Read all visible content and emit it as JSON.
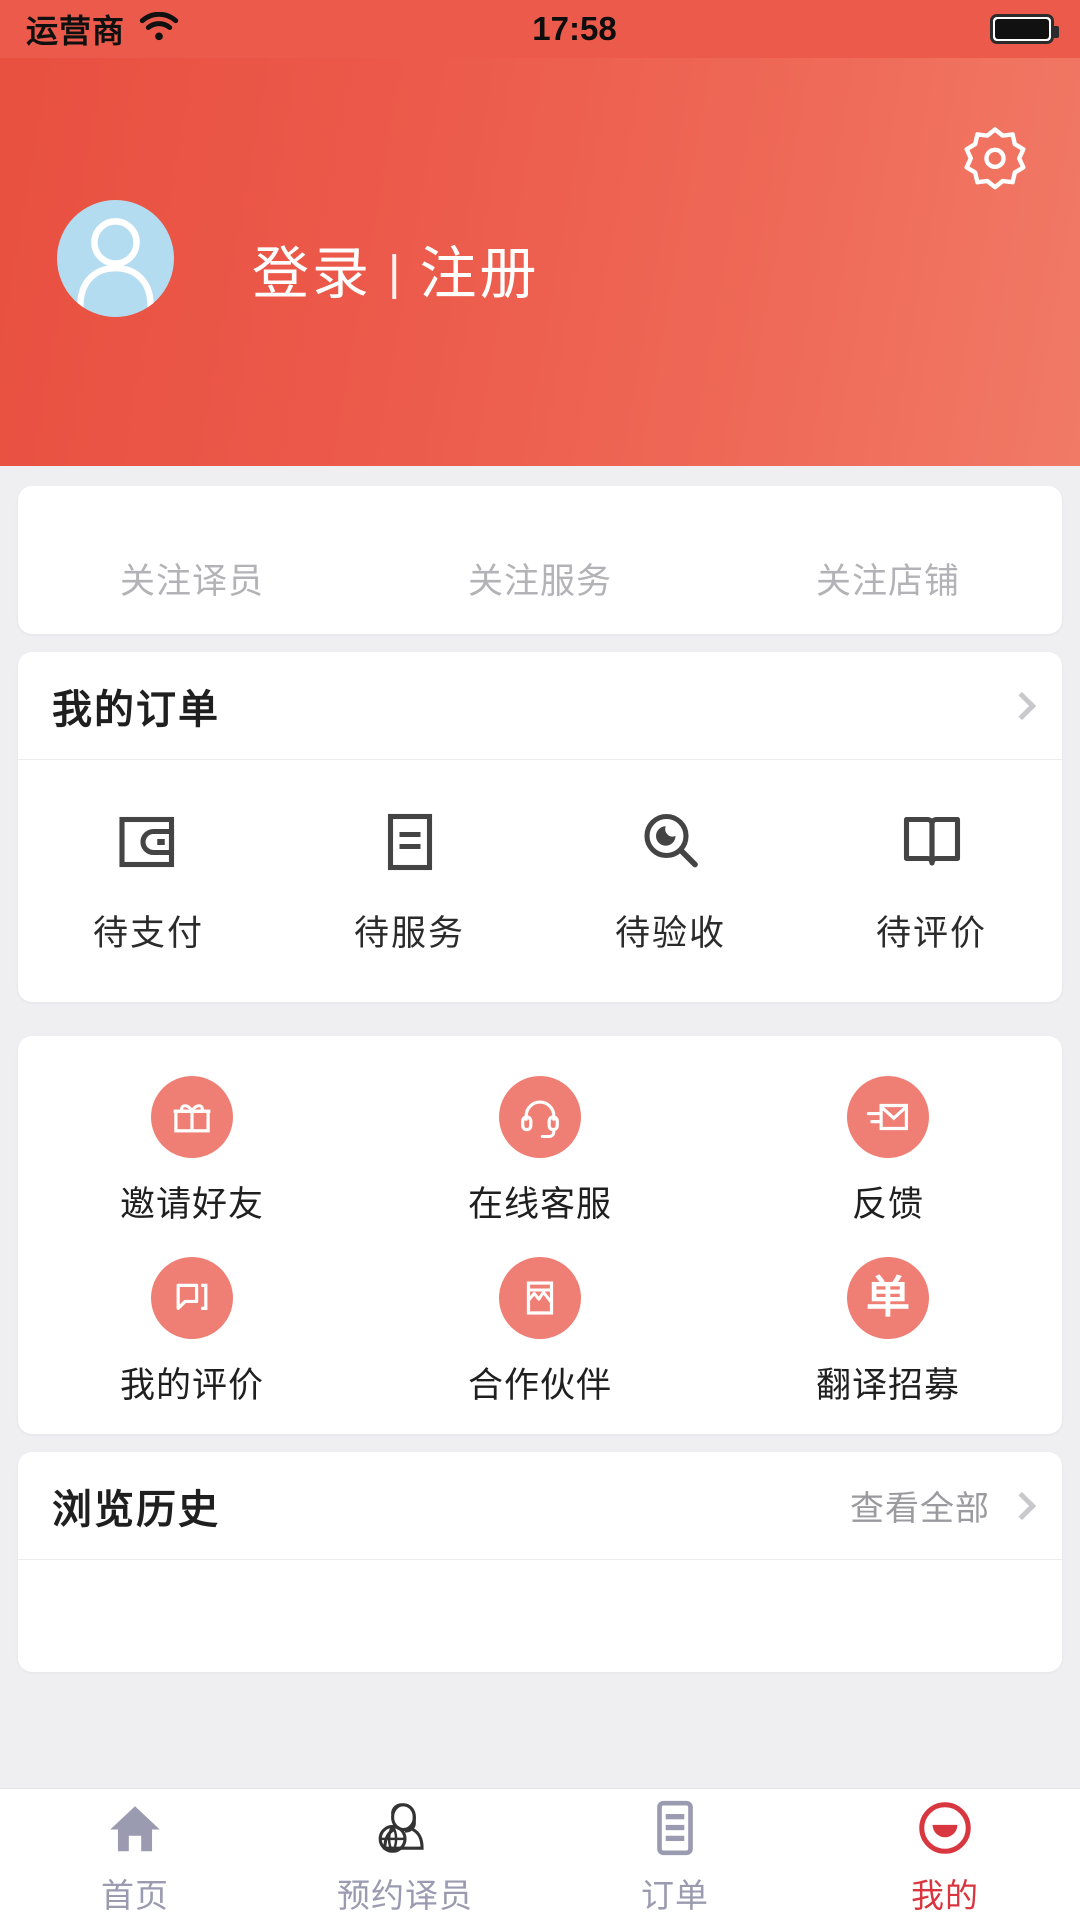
{
  "status_bar": {
    "carrier": "运营商",
    "wifi_icon": "wifi-icon",
    "time": "17:58",
    "battery_icon": "battery-icon"
  },
  "header": {
    "background_color": "#ec5a4b",
    "settings_icon": "gear-icon",
    "avatar_icon": "user-avatar-icon",
    "avatar_bg_color": "#b4dcf0",
    "login_label": "登录",
    "separator": "|",
    "register_label": "注册"
  },
  "follow_card": {
    "items": [
      {
        "label": "关注译员",
        "count": ""
      },
      {
        "label": "关注服务",
        "count": ""
      },
      {
        "label": "关注店铺",
        "count": ""
      }
    ]
  },
  "orders_card": {
    "title": "我的订单",
    "chevron_icon": "chevron-right-icon",
    "items": [
      {
        "label": "待支付",
        "icon": "wallet-icon"
      },
      {
        "label": "待服务",
        "icon": "document-lines-icon"
      },
      {
        "label": "待验收",
        "icon": "magnifier-eye-icon"
      },
      {
        "label": "待评价",
        "icon": "open-book-icon"
      }
    ]
  },
  "shortcuts_card": {
    "accent_color": "#ef7f74",
    "items": [
      {
        "label": "邀请好友",
        "icon": "gift-icon"
      },
      {
        "label": "在线客服",
        "icon": "headset-icon"
      },
      {
        "label": "反馈",
        "icon": "envelope-send-icon"
      },
      {
        "label": "我的评价",
        "icon": "chat-bubble-icon"
      },
      {
        "label": "合作伙伴",
        "icon": "picture-icon"
      },
      {
        "label": "翻译招募",
        "icon": "dan-character-icon"
      }
    ]
  },
  "history_card": {
    "title": "浏览历史",
    "view_all_label": "查看全部",
    "chevron_icon": "chevron-right-icon"
  },
  "tabbar": {
    "active_color": "#d8373f",
    "inactive_color": "#9a9ab0",
    "items": [
      {
        "label": "首页",
        "icon": "home-icon",
        "active": false
      },
      {
        "label": "预约译员",
        "icon": "interpreter-icon",
        "active": false
      },
      {
        "label": "订单",
        "icon": "order-list-icon",
        "active": false
      },
      {
        "label": "我的",
        "icon": "profile-circle-icon",
        "active": true
      }
    ]
  }
}
